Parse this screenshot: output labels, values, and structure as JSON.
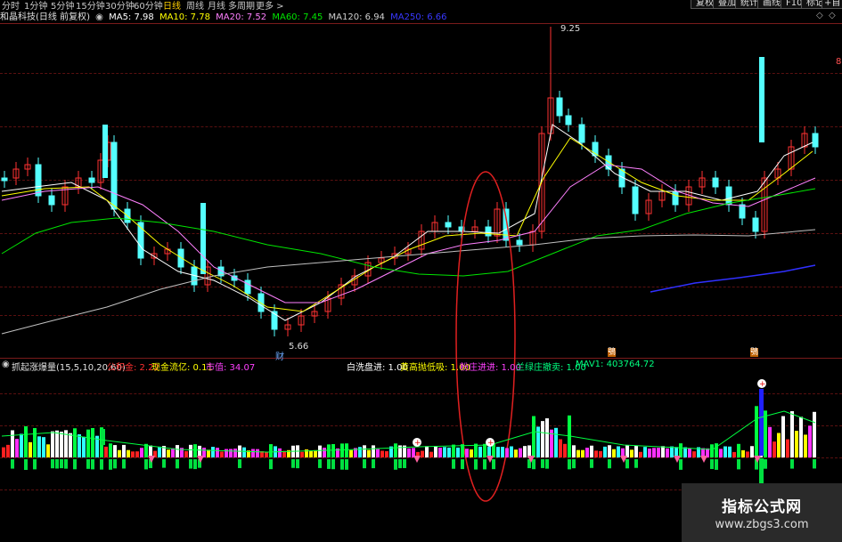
{
  "periods": [
    "分时",
    "1分钟",
    "5分钟",
    "15分钟",
    "30分钟",
    "60分钟",
    "日线",
    "周线",
    "月线",
    "多周期",
    "更多 >"
  ],
  "active_period": "日线",
  "right_buttons": [
    "复权",
    "叠加",
    "统计",
    "画线",
    "F10",
    "标记",
    "+自"
  ],
  "title": {
    "stock": "和晶科技(日线 前复权)",
    "ma5": "MA5: 7.98",
    "ma10": "MA10: 7.78",
    "ma20": "MA20: 7.52",
    "ma60": "MA60: 7.45",
    "ma120": "MA120: 6.94",
    "ma250": "MA250: 6.66"
  },
  "right_edge_label": "8",
  "annotations": {
    "high": "9.25",
    "low": "5.66",
    "cai": "财",
    "hao1": "鴞",
    "hao2": "鴞"
  },
  "indicator": {
    "name": "抓起涨爆量(15,5,10,20,60)",
    "gongjijin": "公积金: 2.22",
    "xianjinliu": "现金流亿: 0.11",
    "shizhi": "市值: 34.07",
    "baixi": "白洗盘进: 1.00",
    "huanggao": "黄高抛低吸: 1.00",
    "fenzhuang": "粉庄进进: 1.00",
    "lanlv": "兰绿庄撤卖: 1.00",
    "mav1": "MAV1: 403764.72"
  },
  "colors": {
    "up": "#ff3232",
    "down": "#54ffff",
    "ma5": "#ffffff",
    "ma10": "#ffff00",
    "ma20": "#ff80ff",
    "ma60": "#00e600",
    "ma120": "#c0c0c0",
    "ma250": "#3030ff"
  },
  "watermark": {
    "line1": "指标公式网",
    "line2": "www.zbgs3.com"
  }
}
